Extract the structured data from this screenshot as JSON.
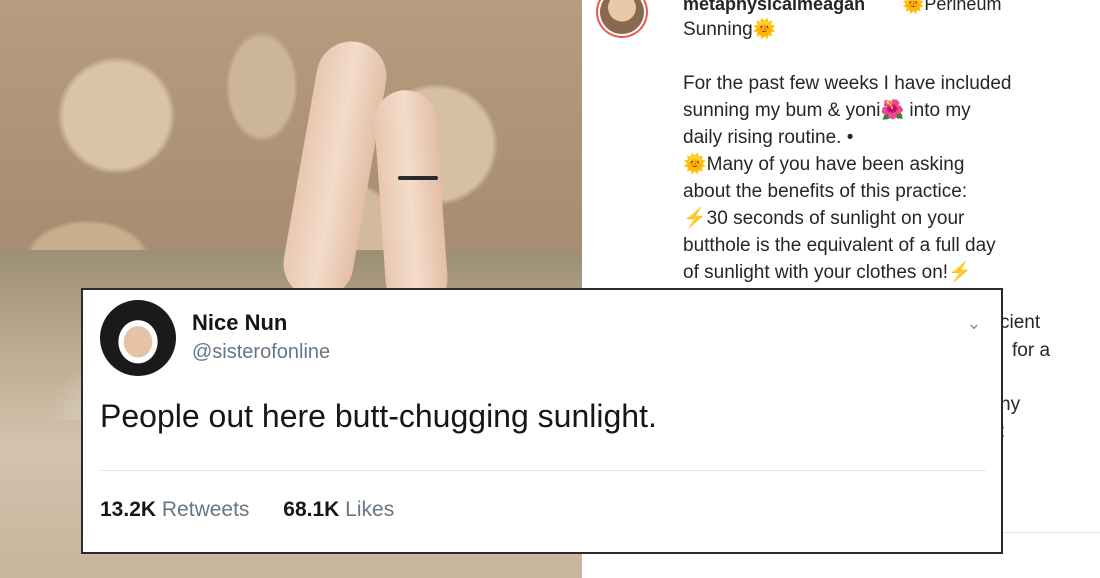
{
  "instagram": {
    "username": "metaphysicalmeagan",
    "location": "🌞Perineum",
    "caption_lines": [
      "Sunning🌞",
      "",
      "For the past few weeks I have included",
      "sunning my bum & yoni🌺 into my",
      "daily rising routine. •",
      "🌞Many of you have been asking",
      "about the benefits of this practice:",
      "⚡30 seconds of sunlight on your",
      "butthole is the equivalent of a full day",
      "of sunlight with your clothes on!⚡"
    ],
    "hidden_tail": [
      "cient",
      "for a",
      "ny",
      ":"
    ]
  },
  "tweet": {
    "display_name": "Nice Nun",
    "handle": "@sisterofonline",
    "text": "People out here butt-chugging sunlight.",
    "retweets_count": "13.2K",
    "retweets_label": "Retweets",
    "likes_count": "68.1K",
    "likes_label": "Likes",
    "chevron": "⌄"
  }
}
